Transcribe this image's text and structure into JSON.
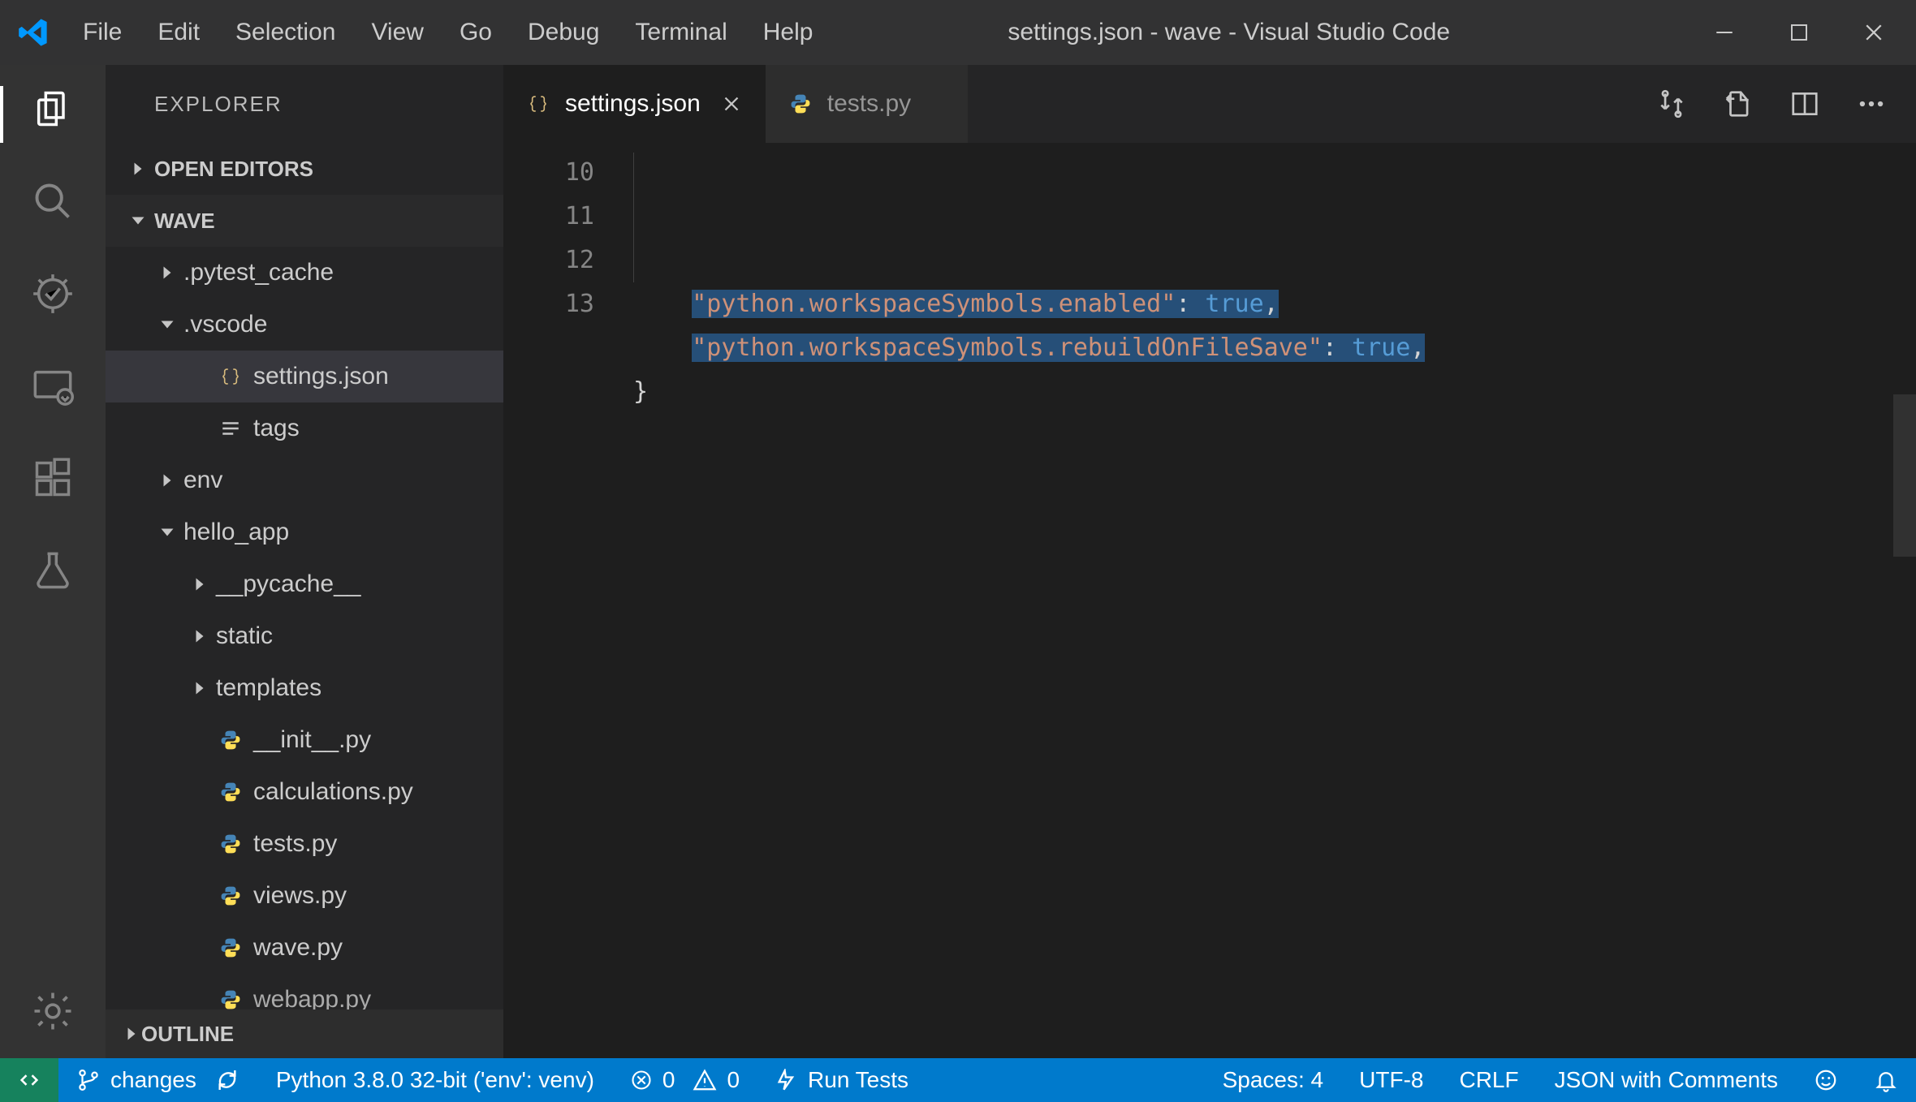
{
  "window": {
    "title": "settings.json - wave - Visual Studio Code"
  },
  "menu": [
    "File",
    "Edit",
    "Selection",
    "View",
    "Go",
    "Debug",
    "Terminal",
    "Help"
  ],
  "sidebar": {
    "title": "EXPLORER",
    "sections": {
      "open_editors": "OPEN EDITORS",
      "workspace": "WAVE",
      "outline": "OUTLINE"
    },
    "tree": [
      {
        "name": ".pytest_cache",
        "type": "folder",
        "expanded": false,
        "depth": 0
      },
      {
        "name": ".vscode",
        "type": "folder",
        "expanded": true,
        "depth": 0
      },
      {
        "name": "settings.json",
        "type": "file",
        "icon": "braces",
        "depth": 1,
        "selected": true
      },
      {
        "name": "tags",
        "type": "file",
        "icon": "lines",
        "depth": 1
      },
      {
        "name": "env",
        "type": "folder",
        "expanded": false,
        "depth": 0
      },
      {
        "name": "hello_app",
        "type": "folder",
        "expanded": true,
        "depth": 0
      },
      {
        "name": "__pycache__",
        "type": "folder",
        "expanded": false,
        "depth": 1
      },
      {
        "name": "static",
        "type": "folder",
        "expanded": false,
        "depth": 1
      },
      {
        "name": "templates",
        "type": "folder",
        "expanded": false,
        "depth": 1
      },
      {
        "name": "__init__.py",
        "type": "file",
        "icon": "python",
        "depth": 1
      },
      {
        "name": "calculations.py",
        "type": "file",
        "icon": "python",
        "depth": 1
      },
      {
        "name": "tests.py",
        "type": "file",
        "icon": "python",
        "depth": 1
      },
      {
        "name": "views.py",
        "type": "file",
        "icon": "python",
        "depth": 1
      },
      {
        "name": "wave.py",
        "type": "file",
        "icon": "python",
        "depth": 1
      },
      {
        "name": "webapp.py",
        "type": "file",
        "icon": "python",
        "depth": 1,
        "cut": true
      }
    ]
  },
  "tabs": [
    {
      "label": "settings.json",
      "icon": "braces",
      "active": true,
      "close": true
    },
    {
      "label": "tests.py",
      "icon": "python",
      "active": false,
      "close": false
    }
  ],
  "editor": {
    "line_numbers": [
      "10",
      "11",
      "12",
      "13"
    ],
    "lines": [
      {
        "indent": "    ",
        "key": "\"python.workspaceSymbols.enabled\"",
        "colon": ": ",
        "value": "true",
        "trail": ",",
        "hl": true
      },
      {
        "indent": "    ",
        "key": "\"python.workspaceSymbols.rebuildOnFileSave\"",
        "colon": ": ",
        "value": "true",
        "trail": ",",
        "hl": true
      },
      {
        "indent": "",
        "brace": "}"
      },
      {
        "indent": "",
        "brace": ""
      }
    ]
  },
  "statusbar": {
    "branch": "changes",
    "python": "Python 3.8.0 32-bit ('env': venv)",
    "errors": "0",
    "warnings": "0",
    "run_tests": "Run Tests",
    "spaces": "Spaces: 4",
    "encoding": "UTF-8",
    "eol": "CRLF",
    "language": "JSON with Comments"
  }
}
